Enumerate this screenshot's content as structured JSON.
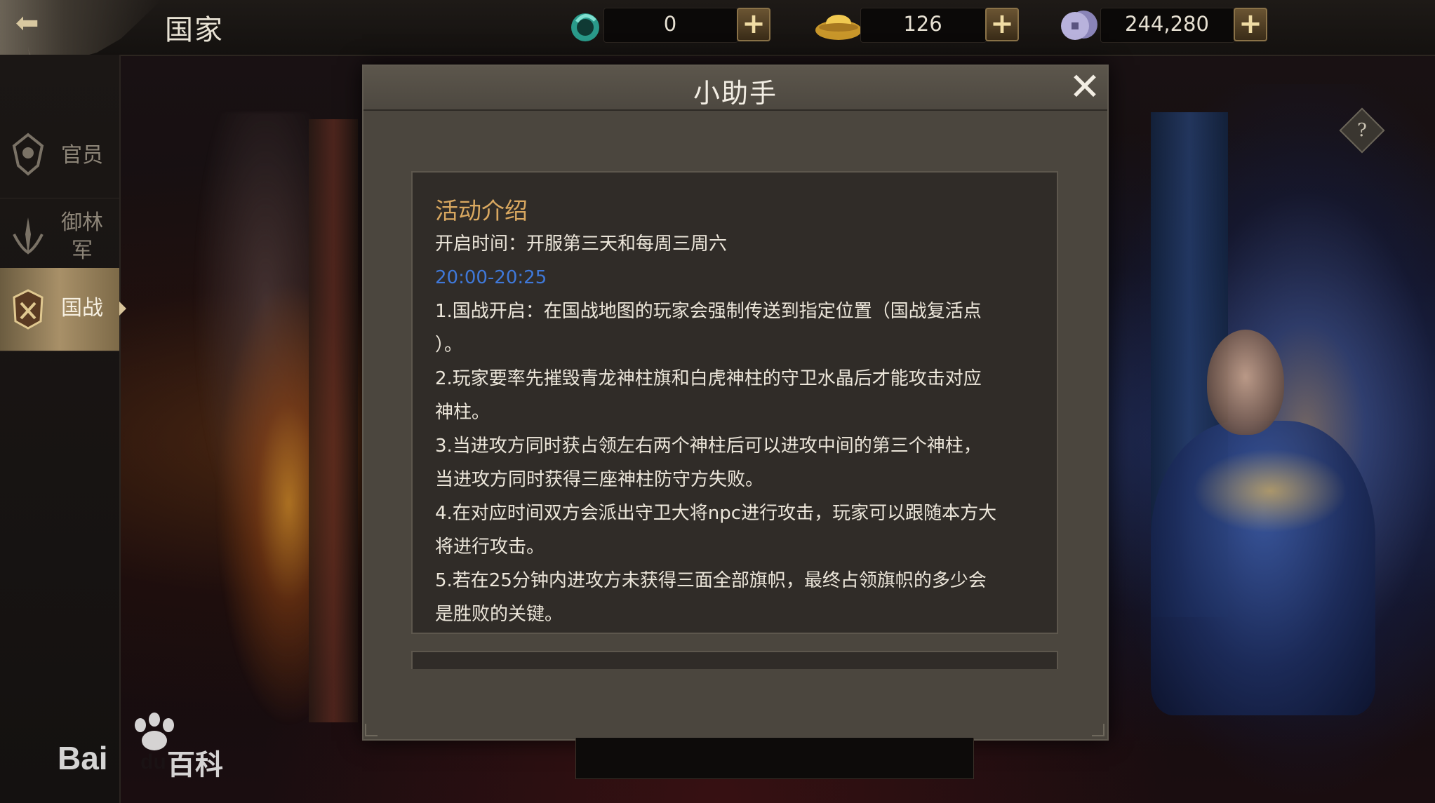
{
  "header": {
    "title": "国家",
    "currencies": [
      {
        "name": "jade",
        "icon": "jade-coin-icon",
        "value": "0"
      },
      {
        "name": "gold-ingot",
        "icon": "gold-ingot-icon",
        "value": "126"
      },
      {
        "name": "silver-coin",
        "icon": "silver-coin-icon",
        "value": "244,280"
      }
    ],
    "plus_label": "+"
  },
  "sidebar": {
    "items": [
      {
        "label": "官员",
        "icon": "official-badge-icon",
        "active": false
      },
      {
        "label": "御林军",
        "label_line1": "御林",
        "label_line2": "军",
        "icon": "imperial-guard-icon",
        "active": false
      },
      {
        "label": "国战",
        "icon": "national-war-icon",
        "active": true
      }
    ]
  },
  "help": {
    "label": "?"
  },
  "dialog": {
    "title": "小助手",
    "close_label": "✕",
    "section_title": "活动介绍",
    "open_time": "开启时间：开服第三天和每周三周六",
    "time_range": "20:00-20:25",
    "rules": [
      "1.国战开启：在国战地图的玩家会强制传送到指定位置（国战复活点",
      "）。",
      "2.玩家要率先摧毁青龙神柱旗和白虎神柱的守卫水晶后才能攻击对应",
      "神柱。",
      "3.当进攻方同时获占领左右两个神柱后可以进攻中间的第三个神柱，",
      "当进攻方同时获得三座神柱防守方失败。",
      "4.在对应时间双方会派出守卫大将npc进行攻击，玩家可以跟随本方大",
      "将进行攻击。",
      "5.若在25分钟内进攻方未获得三面全部旗帜，最终占领旗帜的多少会",
      "是胜败的关键。"
    ]
  },
  "watermark": {
    "text_left": "Bai",
    "text_mid": "du",
    "text_right": "百科"
  },
  "colors": {
    "accent_gold": "#d9a860",
    "time_blue": "#3f78d8",
    "dialog_bg": "#4b463e",
    "content_bg": "#302c28"
  }
}
